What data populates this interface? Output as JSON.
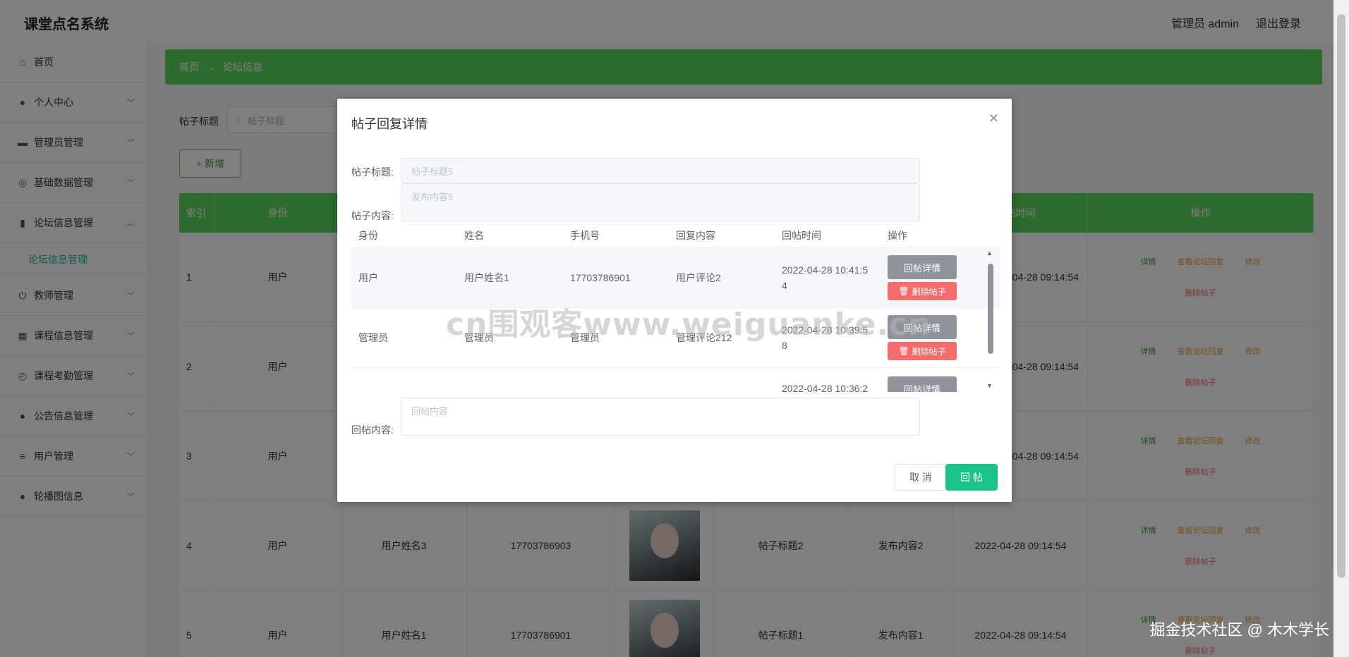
{
  "header": {
    "title": "课堂点名系统",
    "user": "管理员 admin",
    "logout": "退出登录"
  },
  "sidebar": {
    "items": [
      {
        "label": "首页",
        "icon": "home-icon",
        "glyph": "⌂"
      },
      {
        "label": "个人中心",
        "icon": "user-icon",
        "glyph": "●"
      },
      {
        "label": "管理员管理",
        "icon": "briefcase-icon",
        "glyph": "▬"
      },
      {
        "label": "基础数据管理",
        "icon": "compass-icon",
        "glyph": "◎"
      },
      {
        "label": "论坛信息管理",
        "icon": "chart-icon",
        "glyph": "▮"
      },
      {
        "label": "教师管理",
        "icon": "power-icon",
        "glyph": "⏻"
      },
      {
        "label": "课程信息管理",
        "icon": "grid-icon",
        "glyph": "▦"
      },
      {
        "label": "课程考勤管理",
        "icon": "clock-icon",
        "glyph": "◴"
      },
      {
        "label": "公告信息管理",
        "icon": "person-icon",
        "glyph": "●"
      },
      {
        "label": "用户管理",
        "icon": "list-icon",
        "glyph": "≡"
      },
      {
        "label": "轮播图信息",
        "icon": "location-icon",
        "glyph": "●"
      }
    ],
    "sub_active": "论坛信息管理"
  },
  "breadcrumb": {
    "home": "首页",
    "arrow": "→",
    "current": "论坛信息"
  },
  "search": {
    "label": "帖子标题",
    "placeholder": "帖子标题"
  },
  "add_button": "+ 新增",
  "table": {
    "headers": [
      "索引",
      "身份",
      "",
      "",
      "",
      "",
      "",
      "帖时间",
      "操作"
    ],
    "rows": [
      {
        "idx": "1",
        "role": "用户",
        "name": "",
        "phone": "",
        "title": "",
        "content": "",
        "time": "04-28 09:14:54"
      },
      {
        "idx": "2",
        "role": "用户",
        "name": "",
        "phone": "",
        "title": "",
        "content": "",
        "time": "04-28 09:14:54"
      },
      {
        "idx": "3",
        "role": "用户",
        "name": "",
        "phone": "",
        "title": "",
        "content": "",
        "time": "04-28 09:14:54"
      },
      {
        "idx": "4",
        "role": "用户",
        "name": "用户姓名3",
        "phone": "17703786903",
        "title": "帖子标题2",
        "content": "发布内容2",
        "time": "2022-04-28 09:14:54"
      },
      {
        "idx": "5",
        "role": "用户",
        "name": "用户姓名1",
        "phone": "17703786901",
        "title": "帖子标题1",
        "content": "发布内容1",
        "time": "2022-04-28 09:14:54"
      }
    ],
    "ops": {
      "detail": "详情",
      "view": "查看论坛回复",
      "edit": "修改",
      "delete": "删除帖子"
    }
  },
  "dialog": {
    "title": "帖子回复详情",
    "title_label": "帖子标题:",
    "title_value": "帖子标题5",
    "content_label": "帖子内容:",
    "content_value": "发布内容5",
    "columns": [
      "身份",
      "姓名",
      "手机号",
      "回复内容",
      "回帖时间",
      "操作"
    ],
    "rows": [
      {
        "role": "用户",
        "name": "用户姓名1",
        "phone": "17703786901",
        "reply": "用户评论2",
        "time1": "2022-04-28 10:41:5",
        "time2": "4"
      },
      {
        "role": "管理员",
        "name": "管理员",
        "phone": "管理员",
        "reply": "管理评论212",
        "time1": "2022-04-28 10:39:5",
        "time2": "8"
      },
      {
        "role": "",
        "name": "",
        "phone": "",
        "reply": "",
        "time1": "2022-04-28 10:36:2",
        "time2": ""
      }
    ],
    "reply_detail": "回帖详情",
    "delete_post": "删除帖子",
    "reply_label": "回帖内容:",
    "reply_placeholder": "回帖内容",
    "cancel": "取 消",
    "submit": "回 帖"
  },
  "watermark": "cn围观客www.weiguanke.cn",
  "corner_watermark": "掘金技术社区 @ 木木学长",
  "colors": {
    "accent": "#5cd65c",
    "submit": "#1bc28a",
    "danger": "#f56c6c",
    "gray_btn": "#909399"
  }
}
